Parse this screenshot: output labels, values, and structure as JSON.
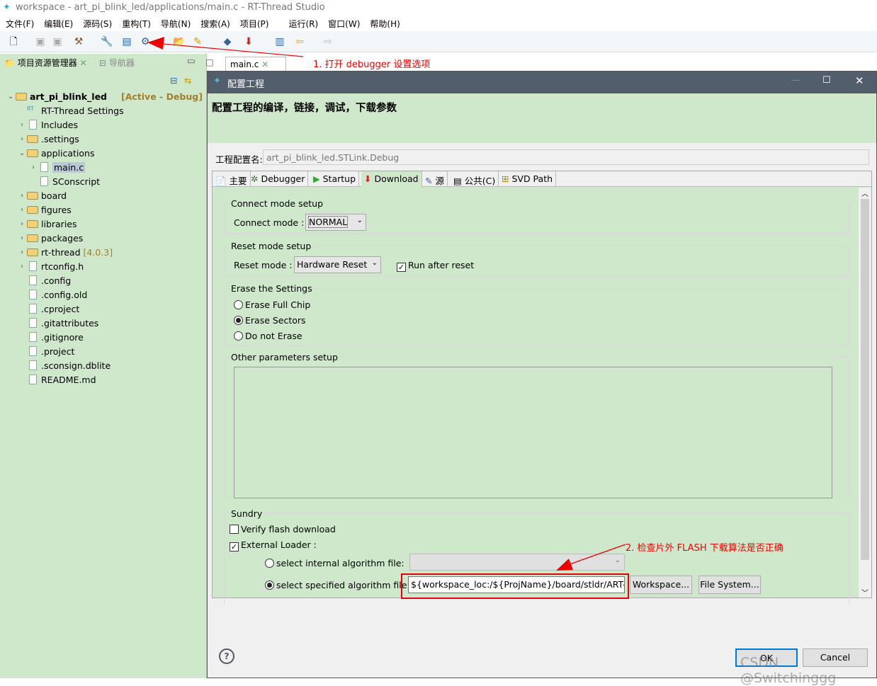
{
  "window": {
    "title": "workspace - art_pi_blink_led/applications/main.c - RT-Thread Studio"
  },
  "menu": [
    "文件(F)",
    "编辑(E)",
    "源码(S)",
    "重构(T)",
    "导航(N)",
    "搜索(A)",
    "项目(P)",
    "运行(R)",
    "窗口(W)",
    "帮助(H)"
  ],
  "panel": {
    "tab1": "项目资源管理器",
    "tab2": "导航器"
  },
  "tree": [
    {
      "label": "art_pi_blink_led",
      "suffix": "[Active - Debug]",
      "level": 0,
      "type": "project",
      "open": true
    },
    {
      "label": "RT-Thread Settings",
      "level": 1,
      "type": "settings"
    },
    {
      "label": "Includes",
      "level": 1,
      "type": "includes",
      "collapsed": true
    },
    {
      "label": ".settings",
      "level": 1,
      "type": "folder",
      "collapsed": true
    },
    {
      "label": "applications",
      "level": 1,
      "type": "folder",
      "open": true
    },
    {
      "label": "main.c",
      "level": 2,
      "type": "c-file",
      "collapsed": true,
      "selected": true
    },
    {
      "label": "SConscript",
      "level": 2,
      "type": "file"
    },
    {
      "label": "board",
      "level": 1,
      "type": "folder",
      "collapsed": true
    },
    {
      "label": "figures",
      "level": 1,
      "type": "folder",
      "collapsed": true
    },
    {
      "label": "libraries",
      "level": 1,
      "type": "folder",
      "collapsed": true
    },
    {
      "label": "packages",
      "level": 1,
      "type": "folder",
      "collapsed": true
    },
    {
      "label": "rt-thread",
      "suffix": "[4.0.3]",
      "level": 1,
      "type": "folder",
      "collapsed": true
    },
    {
      "label": "rtconfig.h",
      "level": 1,
      "type": "h-file",
      "collapsed": true
    },
    {
      "label": ".config",
      "level": 1,
      "type": "file"
    },
    {
      "label": ".config.old",
      "level": 1,
      "type": "file"
    },
    {
      "label": ".cproject",
      "level": 1,
      "type": "file"
    },
    {
      "label": ".gitattributes",
      "level": 1,
      "type": "file"
    },
    {
      "label": ".gitignore",
      "level": 1,
      "type": "file"
    },
    {
      "label": ".project",
      "level": 1,
      "type": "file"
    },
    {
      "label": ".sconsign.dblite",
      "level": 1,
      "type": "file"
    },
    {
      "label": "README.md",
      "level": 1,
      "type": "file"
    }
  ],
  "editor": {
    "tab": "main.c"
  },
  "annotations": {
    "step1": "1. 打开 debugger 设置选项",
    "step2": "2. 检查片外 FLASH 下载算法是否正确",
    "color": "#e00000"
  },
  "dialog": {
    "title": "配置工程",
    "header": "配置工程的编译，链接，调试，下载参数",
    "config_name_label": "工程配置名:",
    "config_name_value": "art_pi_blink_led.STLink.Debug",
    "tabs": [
      "主要",
      "Debugger",
      "Startup",
      "Download",
      "源",
      "公共(C)",
      "SVD Path"
    ],
    "active_tab": "Download",
    "connect": {
      "title": "Connect mode setup",
      "label": "Connect mode :",
      "value": "NORMAL"
    },
    "reset": {
      "title": "Reset mode setup",
      "label": "Reset mode :",
      "value": "Hardware Reset",
      "run_after_reset": "Run after reset"
    },
    "erase": {
      "title": "Erase the Settings",
      "options": [
        "Erase Full Chip",
        "Erase Sectors",
        "Do not Erase"
      ],
      "selected": "Erase Sectors"
    },
    "other": {
      "title": "Other parameters setup",
      "value": ""
    },
    "sundry": {
      "title": "Sundry",
      "verify": "Verify flash download",
      "external": "External Loader :",
      "internal_label": "select internal algorithm file:",
      "internal_value": "",
      "specified_label": "select specified algorithm file:",
      "specified_value": "${workspace_loc:/${ProjName}/board/stldr/ART-Pi_",
      "workspace_btn": "Workspace...",
      "filesystem_btn": "File System..."
    },
    "ok": "OK",
    "cancel": "Cancel"
  },
  "watermark": "CSDN @Switchinggg"
}
